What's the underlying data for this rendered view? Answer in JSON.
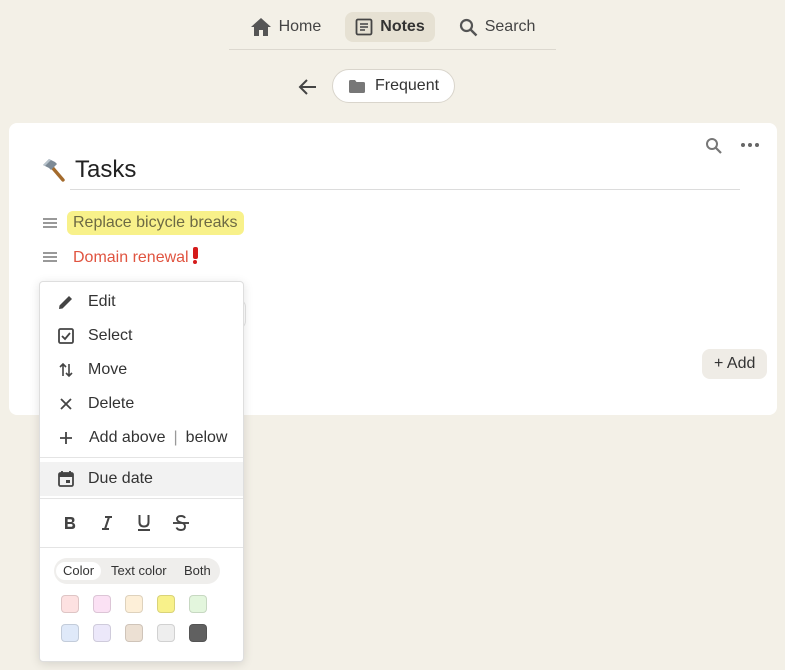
{
  "nav": {
    "home": "Home",
    "notes": "Notes",
    "search": "Search"
  },
  "breadcrumb": {
    "folder": "Frequent"
  },
  "card": {
    "emoji": "🔨",
    "title": "Tasks",
    "items": [
      {
        "text": "Replace bicycle breaks",
        "color": "#f8f18a"
      },
      {
        "text": "Domain renewal",
        "text_color": "#e05440",
        "emoji": "❗"
      }
    ],
    "add_label": "+ Add"
  },
  "menu": {
    "edit": "Edit",
    "select": "Select",
    "move": "Move",
    "delete": "Delete",
    "add_above": "Add above",
    "add_separator": "|",
    "add_below": "below",
    "due_date": "Due date",
    "format_icons": [
      "bold-icon",
      "italic-icon",
      "underline-icon",
      "strikethrough-icon"
    ],
    "color_tabs": {
      "color": "Color",
      "text_color": "Text color",
      "both": "Both",
      "selected": "Color"
    },
    "swatches": [
      "#fde1e1",
      "#fbe1f4",
      "#fdefd8",
      "#f8f18a",
      "#e3f6dd",
      "#dfe9f9",
      "#ece8fa",
      "#ece0d3",
      "#eeeeee",
      "#606060"
    ]
  }
}
